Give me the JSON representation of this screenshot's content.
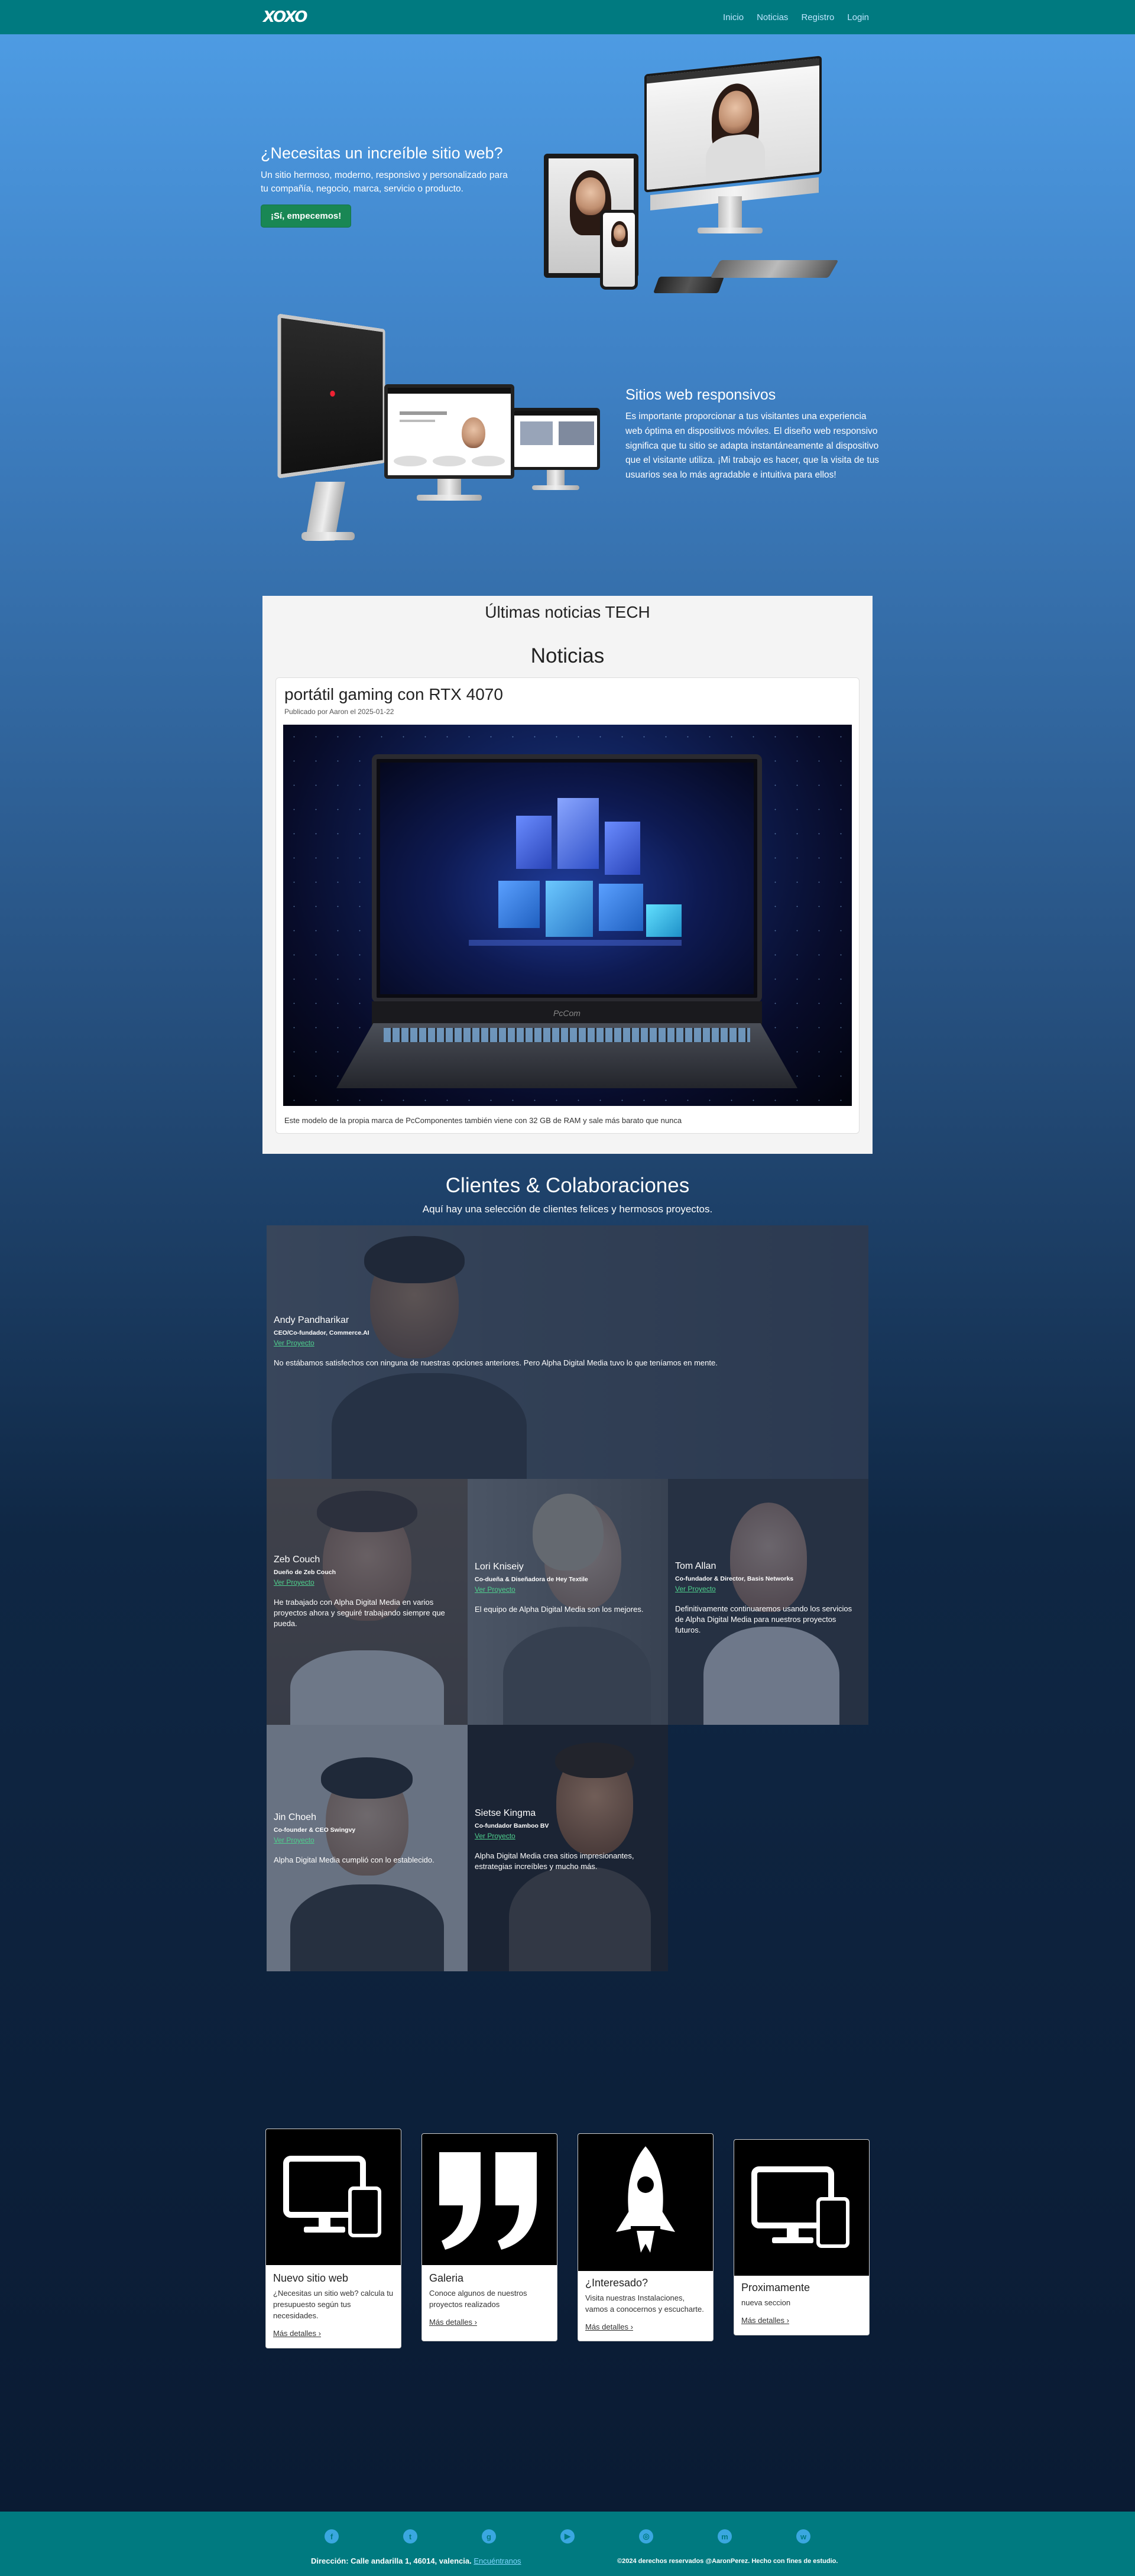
{
  "navbar": {
    "logo": "XOXO",
    "links": [
      "Inicio",
      "Noticias",
      "Registro",
      "Login"
    ]
  },
  "hero1": {
    "title": "¿Necesitas un increíble sitio web?",
    "text": "Un sitio hermoso, moderno, responsivo y personalizado para tu compañía, negocio, marca, servicio o producto.",
    "button": "¡Sí, empecemos!"
  },
  "hero2": {
    "title": "Sitios web responsivos",
    "text": "Es importante proporcionar a tus visitantes una experiencia web óptima en dispositivos móviles. El diseño web responsivo significa que tu sitio se adapta instantáneamente al dispositivo que el visitante utiliza. ¡Mi trabajo es hacer, que la visita de tus usuarios sea lo más agradable e intuitiva para ellos!"
  },
  "news": {
    "subtitle": "Últimas noticias TECH",
    "title": "Noticias",
    "article": {
      "title": "portátil gaming con RTX 4070",
      "meta": "Publicado por Aaron el 2025-01-22",
      "brand_on_laptop": "PcCom",
      "description": "Este modelo de la propia marca de PcComponentes también viene con 32 GB de RAM y sale más barato que nunca"
    }
  },
  "clients": {
    "title": "Clientes & Colaboraciones",
    "subtitle": "Aquí hay una selección de clientes felices y hermosos proyectos.",
    "project_link": "Ver Proyecto",
    "testimonials": [
      {
        "name": "Andy Pandharikar",
        "role": "CEO/Co-fundador, Commerce.AI",
        "quote": "No estábamos satisfechos con ninguna de nuestras opciones anteriores. Pero Alpha Digital Media tuvo lo que teníamos en mente."
      },
      {
        "name": "Zeb Couch",
        "role": "Dueño de Zeb Couch",
        "quote": "He trabajado con Alpha Digital Media en varios proyectos ahora y seguiré trabajando siempre que pueda."
      },
      {
        "name": "Lori Kniseiy",
        "role": "Co-dueña & Diseñadora de Hey Textile",
        "quote": "El equipo de Alpha Digital Media son los mejores."
      },
      {
        "name": "Tom Allan",
        "role": "Co-fundador & Director, Basis Networks",
        "quote": "Definitivamente continuaremos usando los servicios de Alpha Digital Media para nuestros proyectos futuros."
      },
      {
        "name": "Jin Choeh",
        "role": "Co-founder & CEO Swingvy",
        "quote": "Alpha Digital Media cumplió con lo establecido."
      },
      {
        "name": "Sietse Kingma",
        "role": "Co-fundador Bamboo BV",
        "quote": "Alpha Digital Media crea sitios impresionantes, estrategias increíbles y mucho más."
      }
    ]
  },
  "features": {
    "link": "Más detalles",
    "cards": [
      {
        "title": "Nuevo sitio web",
        "text": "¿Necesitas un sitio web? calcula tu presupuesto según tus necesidades.",
        "icon": "devices-icon"
      },
      {
        "title": "Galeria",
        "text": "Conoce algunos de nuestros proyectos realizados",
        "icon": "quote-icon"
      },
      {
        "title": "¿Interesado?",
        "text": "Visita nuestras Instalaciones, vamos a conocernos y escucharte.",
        "icon": "rocket-icon"
      },
      {
        "title": "Proximamente",
        "text": "nueva seccion",
        "icon": "devices-icon"
      }
    ]
  },
  "footer": {
    "social": [
      "facebook-icon",
      "twitter-icon",
      "github-icon",
      "youtube-icon",
      "instagram-icon",
      "messenger-icon",
      "whatsapp-icon"
    ],
    "address_label": "Dirección: Calle andarilla 1, 46014, valencia.",
    "address_link": "Encuéntranos",
    "copyright": "©2024 derechos reservados @AaronPerez. Hecho con fines de estudio."
  },
  "colors": {
    "navbar": "#007a80",
    "accent_green": "#198754",
    "link_green": "#4fd18e",
    "nav_link": "#bfe6ff"
  }
}
